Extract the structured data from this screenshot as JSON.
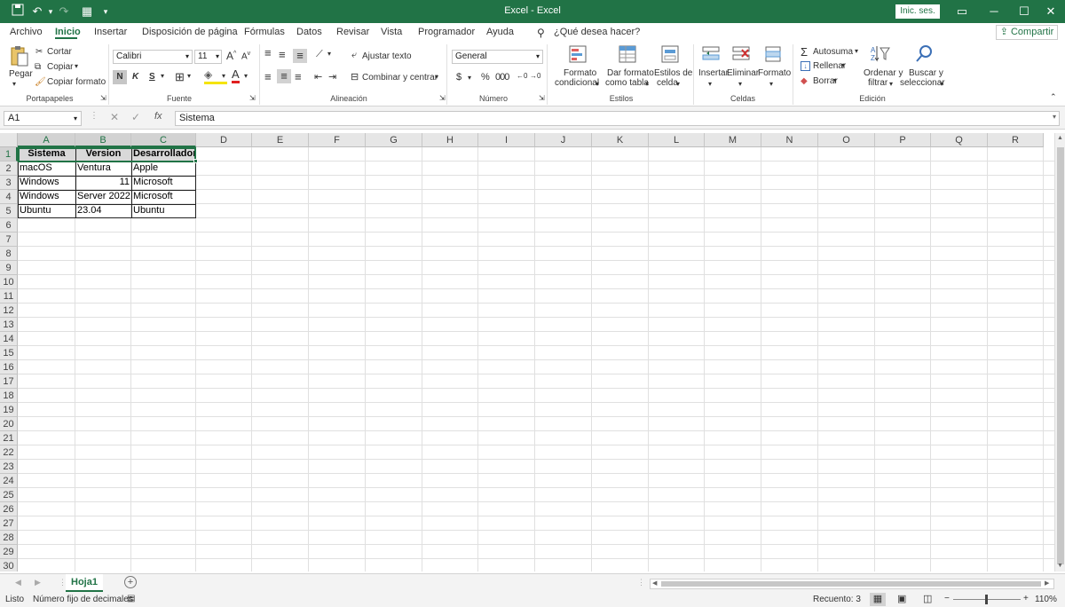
{
  "title": "Excel - Excel",
  "signin": "Inic. ses.",
  "share": "Compartir",
  "menu": [
    "Archivo",
    "Inicio",
    "Insertar",
    "Disposición de página",
    "Fórmulas",
    "Datos",
    "Revisar",
    "Vista",
    "Programador",
    "Ayuda"
  ],
  "tell_me": "¿Qué desea hacer?",
  "ribbon": {
    "paste": "Pegar",
    "cut": "Cortar",
    "copy": "Copiar",
    "format_painter": "Copiar formato",
    "clipboard": "Portapapeles",
    "font_name": "Calibri",
    "font_size": "11",
    "bold": "N",
    "italic": "K",
    "underline": "S",
    "font_group": "Fuente",
    "wrap": "Ajustar texto",
    "merge": "Combinar y centrar",
    "align_group": "Alineación",
    "number_format": "General",
    "currency": "$",
    "percent": "%",
    "number_group": "Número",
    "cond_format": [
      "Formato",
      "condicional"
    ],
    "format_table": [
      "Dar formato",
      "como tabla"
    ],
    "cell_styles": [
      "Estilos de",
      "celda"
    ],
    "styles_group": "Estilos",
    "insert": "Insertar",
    "delete": "Eliminar",
    "format": "Formato",
    "cells_group": "Celdas",
    "autosum": "Autosuma",
    "fill": "Rellenar",
    "clear": "Borrar",
    "sort": [
      "Ordenar y",
      "filtrar"
    ],
    "find": [
      "Buscar y",
      "seleccionar"
    ],
    "edit_group": "Edición"
  },
  "namebox": "A1",
  "formula": "Sistema",
  "columns": [
    "A",
    "B",
    "C",
    "D",
    "E",
    "F",
    "G",
    "H",
    "I",
    "J",
    "K",
    "L",
    "M",
    "N",
    "O",
    "P",
    "Q",
    "R"
  ],
  "rows": [
    "1",
    "2",
    "3",
    "4",
    "5",
    "6",
    "7",
    "8",
    "9",
    "10",
    "11",
    "12",
    "13",
    "14",
    "15",
    "16",
    "17",
    "18",
    "19",
    "20",
    "21",
    "22",
    "23",
    "24",
    "25",
    "26",
    "27",
    "28",
    "29",
    "30"
  ],
  "table": {
    "headers": [
      "Sistema",
      "Version",
      "Desarrollador"
    ],
    "data": [
      [
        "macOS",
        "Ventura",
        "Apple"
      ],
      [
        "Windows",
        "11",
        "Microsoft"
      ],
      [
        "Windows",
        "Server 2022",
        "Microsoft"
      ],
      [
        "Ubuntu",
        "23.04",
        "Ubuntu"
      ]
    ]
  },
  "sheet": "Hoja1",
  "status": {
    "mode": "Listo",
    "fixed": "Número fijo de decimales",
    "count": "Recuento: 3",
    "zoom": "110%"
  },
  "colors": {
    "accent": "#217346"
  }
}
